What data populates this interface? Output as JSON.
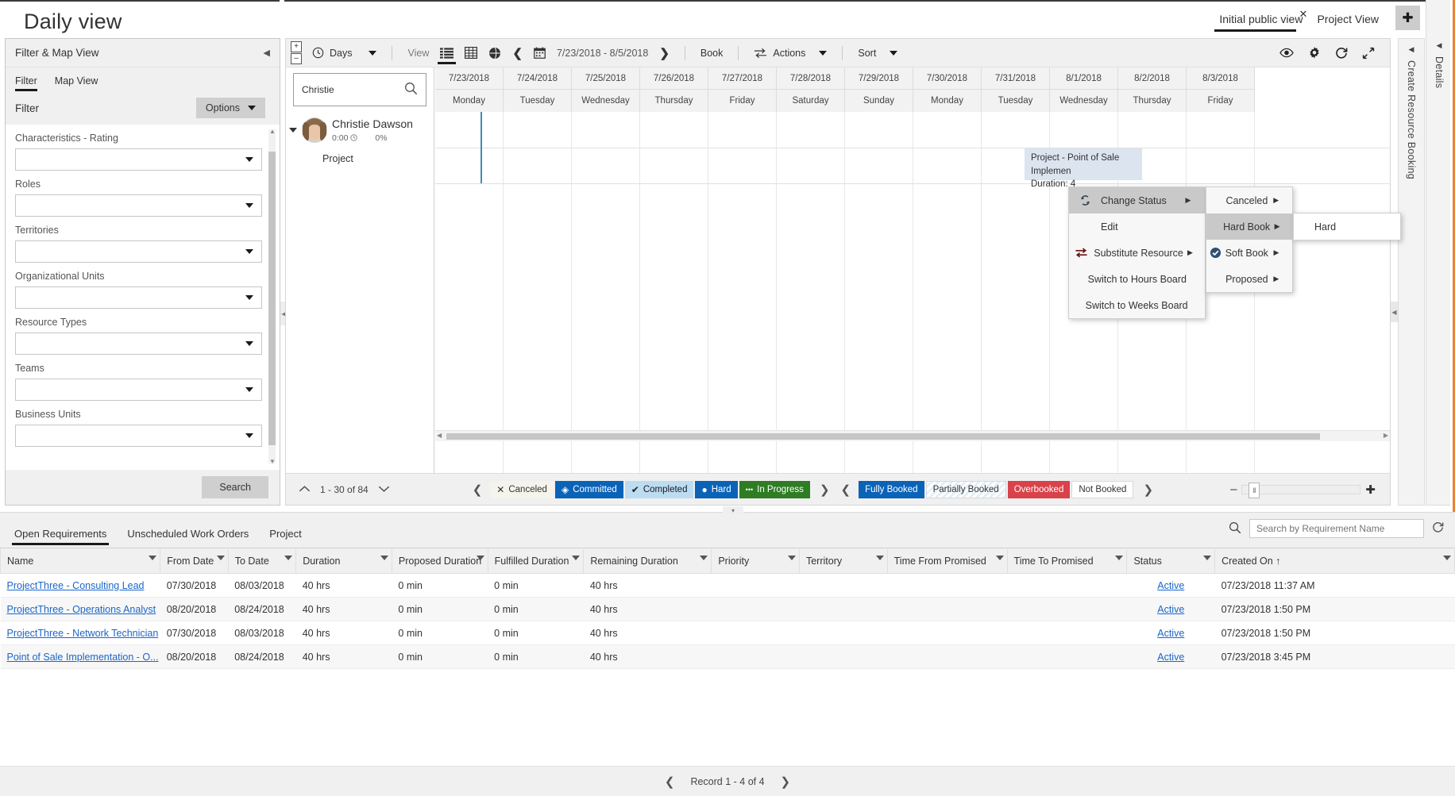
{
  "header": {
    "page_title": "Daily view",
    "tabs": [
      {
        "label": "Initial public view",
        "active": true,
        "closable": true,
        "close_glyph": "✕"
      },
      {
        "label": "Project View",
        "active": false,
        "closable": false
      }
    ],
    "add_button": "✚",
    "settings_button": "⚙"
  },
  "filter_panel": {
    "title": "Filter & Map View",
    "collapse_icon": "◀",
    "tabs": [
      {
        "label": "Filter",
        "active": true
      },
      {
        "label": "Map View",
        "active": false
      }
    ],
    "filter_label": "Filter",
    "options_button": "Options",
    "options_caret": "▼",
    "fields": [
      {
        "label": "Characteristics - Rating",
        "value": ""
      },
      {
        "label": "Roles",
        "value": ""
      },
      {
        "label": "Territories",
        "value": ""
      },
      {
        "label": "Organizational Units",
        "value": ""
      },
      {
        "label": "Resource Types",
        "value": ""
      },
      {
        "label": "Teams",
        "value": ""
      },
      {
        "label": "Business Units",
        "value": ""
      }
    ],
    "search_button": "Search"
  },
  "scheduler": {
    "toolbar": {
      "collapse_left": "◀",
      "expand_all": "+",
      "collapse_all": "–",
      "interval_label": "Days",
      "interval_caret": "▼",
      "view_label": "View",
      "view_list_icon": "list-view-icon",
      "view_grid_icon": "grid-view-icon",
      "view_map_icon": "map-view-icon",
      "prev_icon": "❮",
      "calendar_icon": "calendar-icon",
      "date_range": "7/23/2018 - 8/5/2018",
      "next_icon": "❯",
      "book_label": "Book",
      "actions_label": "Actions",
      "actions_caret": "▼",
      "sort_label": "Sort",
      "sort_caret": "▼",
      "eye_icon": "eye-icon",
      "gear_icon": "gear-icon",
      "refresh_icon": "refresh-icon",
      "fullscreen_icon": "fullscreen-icon"
    },
    "resource_search": {
      "value": "Christie",
      "placeholder": "",
      "icon": "search-icon"
    },
    "resource": {
      "name": "Christie Dawson",
      "hours": "0:00",
      "clock_icon": "clock-icon",
      "utilization": "0%",
      "expand_icon": "▼",
      "child_label": "Project"
    },
    "columns": [
      {
        "date": "7/23/2018",
        "day": "Monday"
      },
      {
        "date": "7/24/2018",
        "day": "Tuesday"
      },
      {
        "date": "7/25/2018",
        "day": "Wednesday"
      },
      {
        "date": "7/26/2018",
        "day": "Thursday"
      },
      {
        "date": "7/27/2018",
        "day": "Friday"
      },
      {
        "date": "7/28/2018",
        "day": "Saturday"
      },
      {
        "date": "7/29/2018",
        "day": "Sunday"
      },
      {
        "date": "7/30/2018",
        "day": "Monday"
      },
      {
        "date": "7/31/2018",
        "day": "Tuesday"
      },
      {
        "date": "8/1/2018",
        "day": "Wednesday"
      },
      {
        "date": "8/2/2018",
        "day": "Thursday"
      },
      {
        "date": "8/3/2018",
        "day": "Friday"
      }
    ],
    "booking": {
      "line1": "Project - Point of Sale Implemen",
      "line2": "Duration: 4"
    },
    "footer": {
      "page_up": "⌃",
      "page_range": "1 - 30 of 84",
      "page_down": "⌄",
      "legend_prev": "❮",
      "legend_next": "❯",
      "status_legend": [
        {
          "label": "Canceled",
          "glyph": "✕",
          "bg": "#f4f4ec",
          "fg": "#333"
        },
        {
          "label": "Committed",
          "glyph": "◈",
          "bg": "#0b63b8",
          "fg": "#ffffff"
        },
        {
          "label": "Completed",
          "glyph": "✔",
          "bg": "#bcdcf2",
          "fg": "#1a1a1a"
        },
        {
          "label": "Hard",
          "glyph": "●",
          "bg": "#0b63b8",
          "fg": "#ffffff"
        },
        {
          "label": "In Progress",
          "glyph": "•••",
          "bg": "#2e7d23",
          "fg": "#ffffff"
        }
      ],
      "booking_prev": "❮",
      "booking_next": "❯",
      "booking_legend": [
        {
          "label": "Fully Booked",
          "bg": "#0b63b8",
          "fg": "#ffffff"
        },
        {
          "label": "Partially Booked",
          "bg": "#ffffff",
          "fg": "#333"
        },
        {
          "label": "Overbooked",
          "bg": "#d9424a",
          "fg": "#ffffff"
        },
        {
          "label": "Not Booked",
          "bg": "#ffffff",
          "fg": "#333"
        }
      ],
      "zoom_out": "–",
      "zoom_in": "✚",
      "zoom_handle": "‖"
    }
  },
  "context_menu": {
    "items": [
      {
        "label": "Change Status",
        "icon": "change-status-icon",
        "submenu": true,
        "hover": true
      },
      {
        "label": "Edit",
        "icon": "",
        "submenu": false,
        "hover": false
      },
      {
        "label": "Substitute Resource",
        "icon": "substitute-resource-icon",
        "submenu": true,
        "hover": false
      },
      {
        "label": "Switch to Hours Board",
        "icon": "",
        "submenu": false,
        "hover": false
      },
      {
        "label": "Switch to Weeks Board",
        "icon": "",
        "submenu": false,
        "hover": false
      }
    ],
    "status_submenu": [
      {
        "label": "Canceled",
        "submenu": true,
        "checked": false,
        "hover": false
      },
      {
        "label": "Hard Book",
        "submenu": true,
        "checked": false,
        "hover": true
      },
      {
        "label": "Soft Book",
        "submenu": true,
        "checked": true,
        "hover": false
      },
      {
        "label": "Proposed",
        "submenu": true,
        "checked": false,
        "hover": false
      }
    ],
    "hard_submenu": [
      {
        "label": "Hard"
      }
    ],
    "check_glyph": "✔",
    "arrow_glyph": "▶"
  },
  "rails": {
    "details": {
      "label": "Details",
      "arrow": "◀"
    },
    "create_booking": {
      "label": "Create Resource Booking",
      "arrow": "◀"
    }
  },
  "bottom_grid": {
    "tabs": [
      {
        "label": "Open Requirements",
        "active": true
      },
      {
        "label": "Unscheduled Work Orders",
        "active": false
      },
      {
        "label": "Project",
        "active": false
      }
    ],
    "search": {
      "placeholder": "Search by Requirement Name",
      "value": "",
      "icon": "search-icon",
      "refresh_icon": "refresh-icon"
    },
    "columns": [
      "Name",
      "From Date",
      "To Date",
      "Duration",
      "Proposed Duration",
      "Fulfilled Duration",
      "Remaining Duration",
      "Priority",
      "Territory",
      "Time From Promised",
      "Time To Promised",
      "Status",
      "Created On ↑"
    ],
    "rows": [
      {
        "name": "ProjectThree - Consulting Lead",
        "from": "07/30/2018",
        "to": "08/03/2018",
        "duration": "40 hrs",
        "proposed": "0 min",
        "fulfilled": "0 min",
        "remaining": "40 hrs",
        "priority": "",
        "territory": "",
        "tfp": "",
        "ttp": "",
        "status": "Active",
        "created": "07/23/2018 11:37 AM"
      },
      {
        "name": "ProjectThree - Operations Analyst",
        "from": "08/20/2018",
        "to": "08/24/2018",
        "duration": "40 hrs",
        "proposed": "0 min",
        "fulfilled": "0 min",
        "remaining": "40 hrs",
        "priority": "",
        "territory": "",
        "tfp": "",
        "ttp": "",
        "status": "Active",
        "created": "07/23/2018 1:50 PM"
      },
      {
        "name": "ProjectThree - Network Technician",
        "from": "07/30/2018",
        "to": "08/03/2018",
        "duration": "40 hrs",
        "proposed": "0 min",
        "fulfilled": "0 min",
        "remaining": "40 hrs",
        "priority": "",
        "territory": "",
        "tfp": "",
        "ttp": "",
        "status": "Active",
        "created": "07/23/2018 1:50 PM"
      },
      {
        "name": "Point of Sale Implementation - O...",
        "from": "08/20/2018",
        "to": "08/24/2018",
        "duration": "40 hrs",
        "proposed": "0 min",
        "fulfilled": "0 min",
        "remaining": "40 hrs",
        "priority": "",
        "territory": "",
        "tfp": "",
        "ttp": "",
        "status": "Active",
        "created": "07/23/2018 3:45 PM"
      }
    ],
    "record_nav": {
      "prev": "❮",
      "label": "Record 1 - 4 of 4",
      "next": "❯"
    }
  },
  "colors": {
    "accent": "#0b63b8",
    "overbooked": "#d9424a",
    "inprogress": "#2e7d23",
    "edge": "#e8833a",
    "nowline": "#3c8dbc"
  }
}
